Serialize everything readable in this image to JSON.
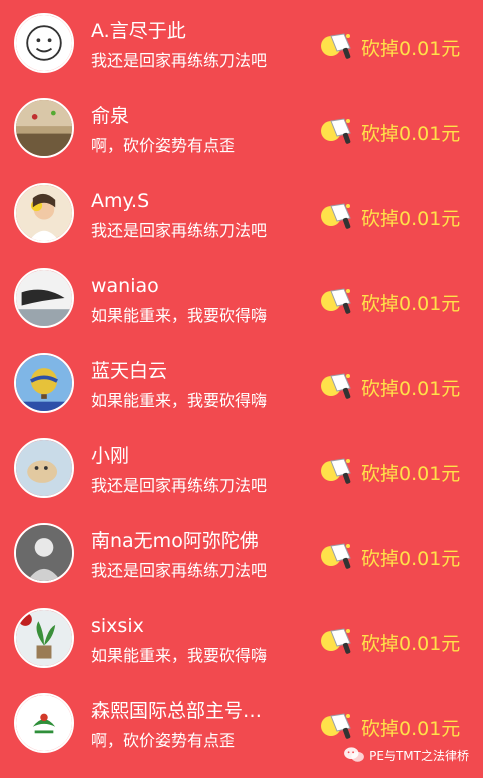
{
  "rows": [
    {
      "name": "A.言尽于此",
      "message": "我还是回家再练练刀法吧",
      "amount": "砍掉0.01元",
      "avatar_icon": "cartoon-face-avatar"
    },
    {
      "name": "俞泉",
      "message": "啊，砍价姿势有点歪",
      "amount": "砍掉0.01元",
      "avatar_icon": "balloons-landscape-avatar"
    },
    {
      "name": "Amy.S",
      "message": "我还是回家再练练刀法吧",
      "amount": "砍掉0.01元",
      "avatar_icon": "girl-with-flower-avatar"
    },
    {
      "name": "waniao",
      "message": "如果能重来，我要砍得嗨",
      "amount": "砍掉0.01元",
      "avatar_icon": "bird-beak-avatar"
    },
    {
      "name": "蓝天白云",
      "message": "如果能重来，我要砍得嗨",
      "amount": "砍掉0.01元",
      "avatar_icon": "hot-air-balloon-avatar"
    },
    {
      "name": "小刚",
      "message": "我还是回家再练练刀法吧",
      "amount": "砍掉0.01元",
      "avatar_icon": "dog-photo-avatar"
    },
    {
      "name": "南na无mo阿弥陀佛",
      "message": "我还是回家再练练刀法吧",
      "amount": "砍掉0.01元",
      "avatar_icon": "person-silhouette-avatar"
    },
    {
      "name": "sixsix",
      "message": "如果能重来，我要砍得嗨",
      "amount": "砍掉0.01元",
      "avatar_icon": "plant-pot-avatar"
    },
    {
      "name": "森熙国际总部主号…",
      "message": "啊，砍价姿势有点歪",
      "amount": "砍掉0.01元",
      "avatar_icon": "green-logo-avatar"
    }
  ],
  "watermark": {
    "text": "PE与TMT之法律桥",
    "icon": "wechat-icon"
  },
  "colors": {
    "background": "#f24a4f",
    "amount_text": "#ffe14a",
    "text": "#ffffff"
  }
}
